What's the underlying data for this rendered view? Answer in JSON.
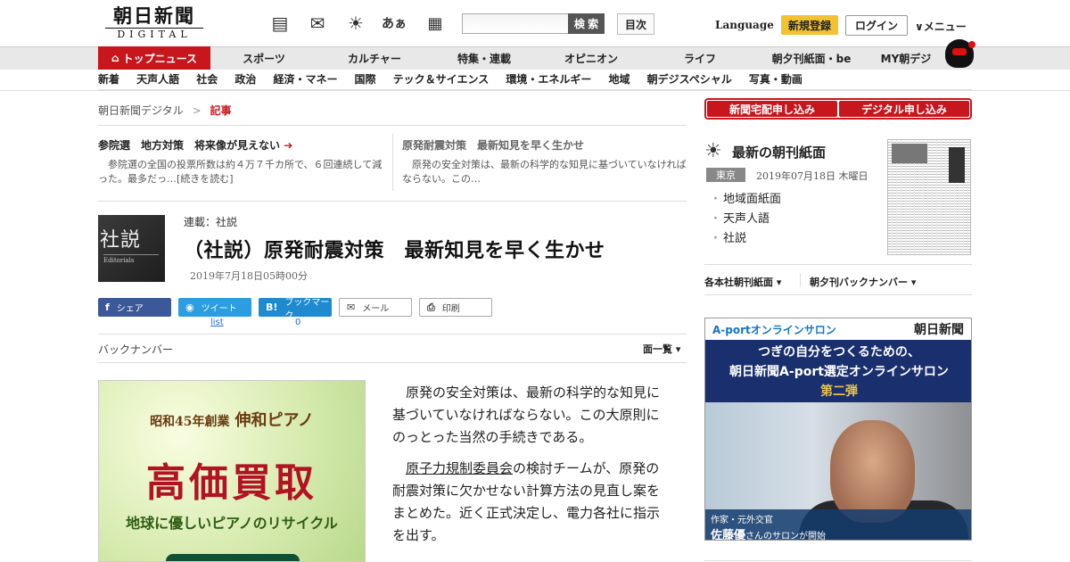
{
  "header": {
    "logo_main": "朝日新聞",
    "logo_sub": "DIGITAL",
    "hiragana_icon": "あぁ",
    "search_placeholder": "",
    "search_button": "検 索",
    "toc_button": "目次",
    "language": "Language",
    "register": "新規登録",
    "login": "ログイン",
    "menu": "メニュー"
  },
  "nav1": [
    "トップニュース",
    "スポーツ",
    "カルチャー",
    "特集・連載",
    "オピニオン",
    "ライフ",
    "朝夕刊紙面・be",
    "MY朝デジ"
  ],
  "nav2": [
    "新着",
    "天声人語",
    "社会",
    "政治",
    "経済・マネー",
    "国際",
    "テック＆サイエンス",
    "環境・エネルギー",
    "地域",
    "朝デジスペシャル",
    "写真・動画"
  ],
  "breadcrumb": {
    "home": "朝日新聞デジタル",
    "sep": ">",
    "current": "記事"
  },
  "teasers": [
    {
      "title": "参院選　地方対策　将来像が見えない",
      "desc": "参院選の全国の投票所数は約４万７千カ所で、６回連続して減った。最多だっ…[続きを読む]"
    },
    {
      "title": "原発耐震対策　最新知見を早く生かせ",
      "desc": "原発の安全対策は、最新の科学的な知見に基づいていなければならない。この…"
    }
  ],
  "article": {
    "thumb_kanji": "社説",
    "thumb_en": "Editorials",
    "series": "連載：社説",
    "title": "（社説）原発耐震対策　最新知見を早く生かせ",
    "date": "2019年7月18日05時00分",
    "share": {
      "facebook": "シェア",
      "twitter": "ツイート",
      "hatena": "ブックマーク",
      "mail": "メール",
      "print": "印刷",
      "twitter_count": "list",
      "hatena_count": "0"
    },
    "back_number": "バックナンバー",
    "page_menu": "面一覧",
    "para1": "原発の安全対策は、最新の科学的な知見に基づいていなければならない。この大原則にのっとった当然の手続きである。",
    "para2_link": "原子力規制委員会",
    "para2_rest": "の検討チームが、原発の耐震対策に欠かせない計算方法の見直し案をまとめた。近く正式決定し、電力各社に指示を出す。"
  },
  "ad": {
    "l1": "昭和45年創業",
    "l1b": "伸和ピアノ",
    "l2": "高価買取",
    "l3": "地球に優しいピアノのリサイクル"
  },
  "right": {
    "btn_delivery": "新聞宅配申し込み",
    "btn_digital": "デジタル申し込み",
    "paper_title": "最新の朝刊紙面",
    "region": "東京",
    "paper_date": "2019年07月18日 木曜日",
    "links": [
      "地域面紙面",
      "天声人語",
      "社説"
    ],
    "menu_local": "各本社朝刊紙面",
    "menu_back": "朝夕刊バックナンバー"
  },
  "aport": {
    "brand": "A-portオンラインサロン",
    "paper": "朝日新聞",
    "line1": "つぎの自分をつくるための、",
    "line2": "朝日新聞A-port選定オンラインサロン",
    "line3": "第二弾",
    "cap1": "作家・元外交官",
    "cap2": "佐藤優",
    "cap2b": "さんのサロンが開始"
  },
  "colors": {
    "brand_red": "#c8161d",
    "register_yellow": "#f2c232",
    "facebook": "#3b5998",
    "twitter": "#2b9de0"
  }
}
